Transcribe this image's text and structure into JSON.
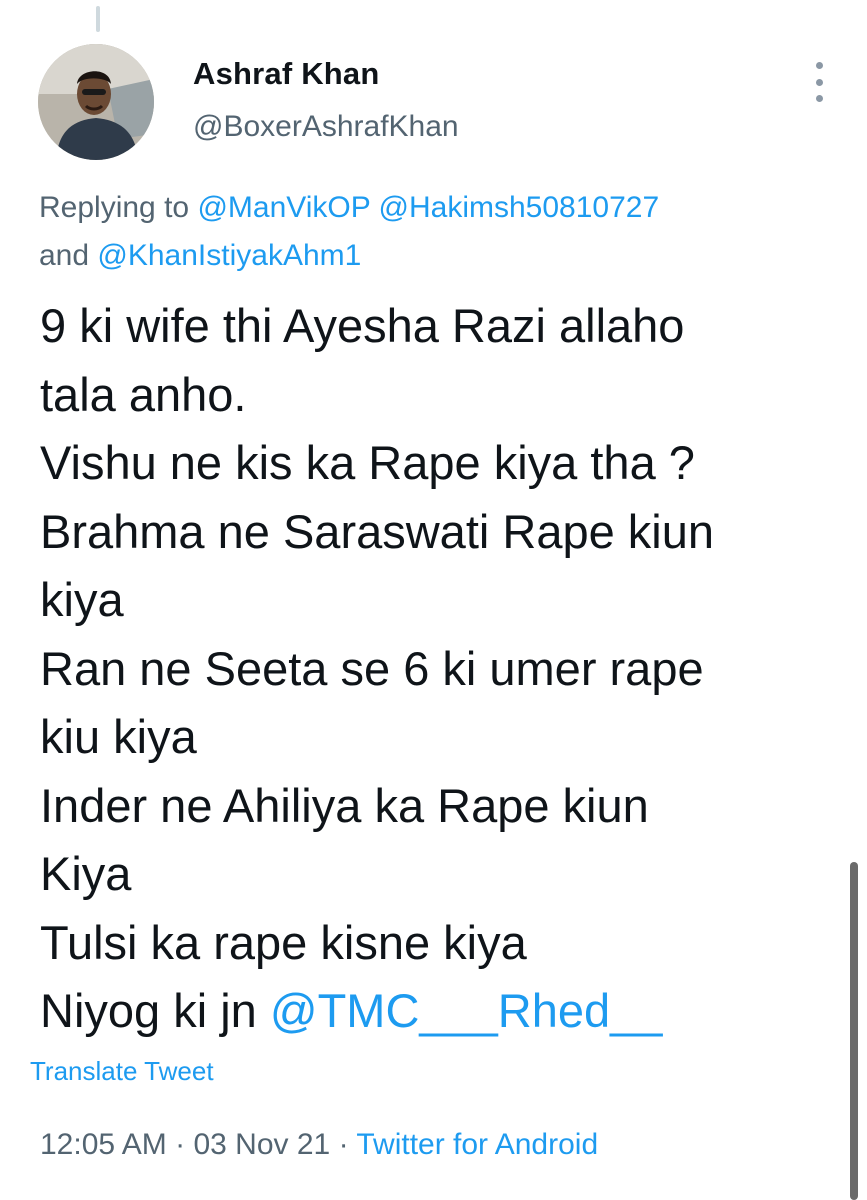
{
  "tweet": {
    "author_name": "Ashraf Khan",
    "author_handle": "@BoxerAshrafKhan",
    "replying_prefix": "Replying to",
    "reply_mentions": [
      "@ManVikOP",
      "@Hakimsh50810727",
      "@KhanIstiyakAhm1"
    ],
    "replying_conjunction": "and",
    "text_lines": [
      "9 ki wife thi Ayesha Razi allaho",
      "tala anho.",
      "Vishu ne kis ka Rape kiya tha ?",
      "Brahma ne Saraswati Rape kiun",
      "kiya",
      "Ran ne Seeta se 6 ki umer rape",
      "kiu kiya",
      "Inder ne Ahiliya ka Rape kiun",
      "Kiya",
      "Tulsi ka rape kisne kiya"
    ],
    "last_line_text": "Niyog ki jn",
    "last_line_mention": "@TMC___Rhed__",
    "translate_label": "Translate Tweet",
    "time": "12:05 AM",
    "date": "03 Nov 21",
    "separator": "·",
    "source": "Twitter for Android"
  },
  "icons": {
    "more": "more-vertical-icon",
    "avatar": "avatar"
  },
  "colors": {
    "link": "#1d9bf0",
    "secondary_text": "#536471",
    "primary_text": "#0f1419"
  }
}
